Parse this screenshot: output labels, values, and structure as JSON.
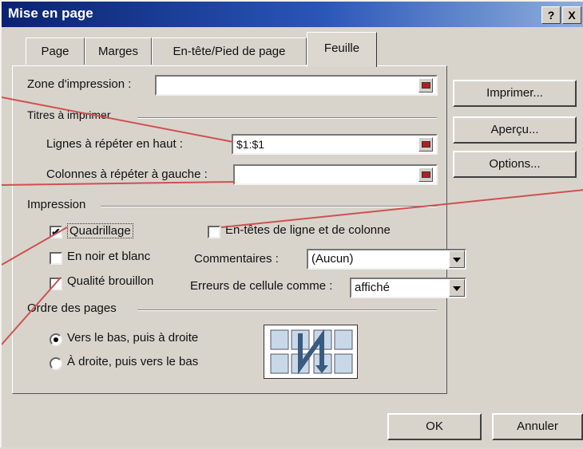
{
  "title": "Mise en page",
  "help_btn": "?",
  "close_btn": "X",
  "tabs": [
    {
      "label": "Page"
    },
    {
      "label": "Marges"
    },
    {
      "label": "En-tête/Pied de page"
    },
    {
      "label": "Feuille"
    }
  ],
  "print_area": {
    "label": "Zone d'impression :",
    "value": ""
  },
  "titles_group": "Titres à imprimer",
  "rows_repeat": {
    "label": "Lignes à répéter en haut :",
    "value": "$1:$1"
  },
  "cols_repeat": {
    "label": "Colonnes à répéter à gauche :",
    "value": ""
  },
  "print_group": "Impression",
  "gridlines": {
    "label": "Quadrillage",
    "checked": true
  },
  "black_white": {
    "label": "En noir et blanc",
    "checked": false
  },
  "draft": {
    "label": "Qualité brouillon",
    "checked": false
  },
  "headings": {
    "label": "En-têtes de ligne et de colonne",
    "checked": false
  },
  "comments": {
    "label": "Commentaires :",
    "value": "(Aucun)"
  },
  "cell_errors": {
    "label": "Erreurs de cellule comme :",
    "value": "affiché"
  },
  "order_group": "Ordre des pages",
  "order_down": {
    "label": "Vers le bas, puis à droite",
    "selected": true
  },
  "order_over": {
    "label": "À droite, puis vers le bas",
    "selected": false
  },
  "buttons": {
    "print": "Imprimer...",
    "preview": "Aperçu...",
    "options": "Options...",
    "ok": "OK",
    "cancel": "Annuler"
  },
  "colors": {
    "title_start": "#0a2270",
    "title_end": "#8fb0dc",
    "callout": "#d05050"
  }
}
